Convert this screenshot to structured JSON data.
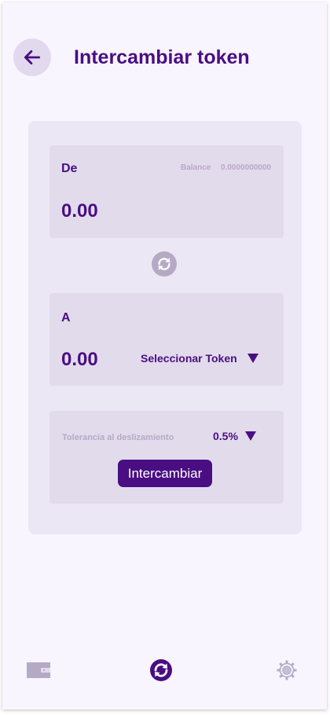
{
  "header": {
    "title": "Intercambiar token",
    "back_icon": "arrow-left-icon"
  },
  "from": {
    "label": "De",
    "balance_label": "Balance",
    "balance_value": "0.0000000000",
    "amount": "0.00"
  },
  "swap_direction_icon": "refresh-icon",
  "to": {
    "label": "A",
    "amount": "0.00",
    "select_label": "Seleccionar Token",
    "dropdown_icon": "triangle-down-icon"
  },
  "slippage": {
    "label": "Tolerancia al deslizamiento",
    "value": "0.5%",
    "dropdown_icon": "triangle-down-icon"
  },
  "action": {
    "button_label": "Intercambiar"
  },
  "bottom_nav": [
    {
      "icon": "wallet-icon",
      "active": false
    },
    {
      "icon": "swap-icon",
      "active": true
    },
    {
      "icon": "gear-icon",
      "active": false
    }
  ],
  "colors": {
    "primary": "#4a0e83",
    "muted": "#b6a9c6",
    "panel": "#e2dbeb",
    "card": "#ece7f5",
    "background": "#f8f5ff"
  }
}
